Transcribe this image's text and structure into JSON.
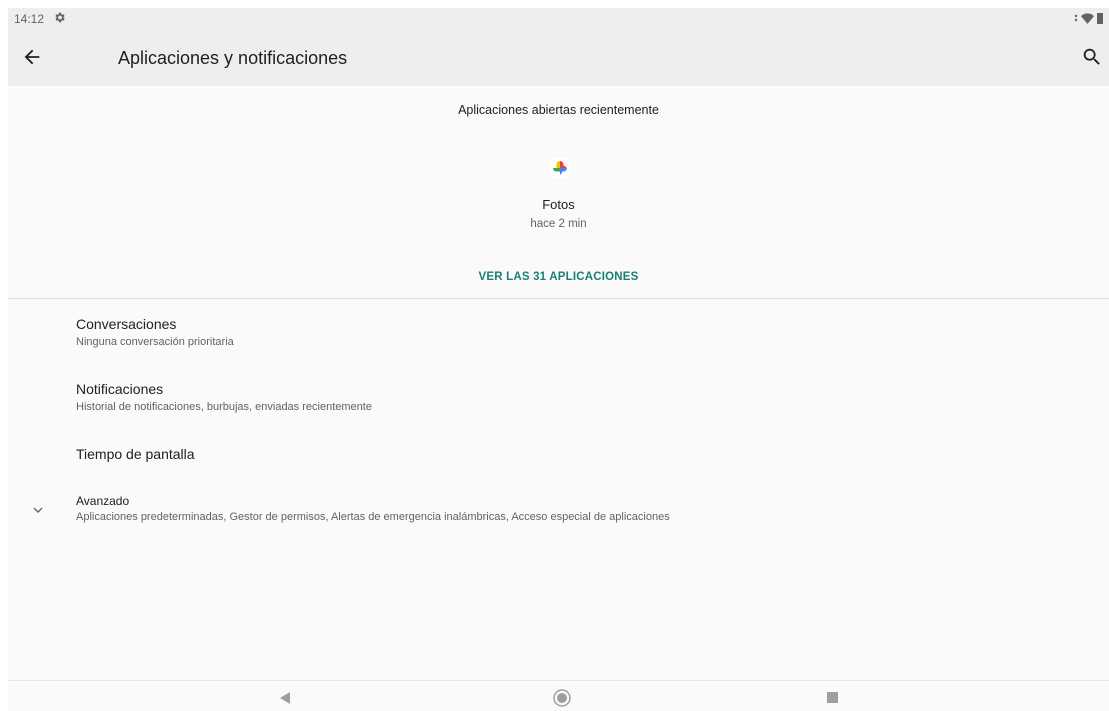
{
  "status_bar": {
    "time": "14:12",
    "icons": [
      "gear-icon",
      "wifi-icon",
      "battery-icon"
    ]
  },
  "toolbar": {
    "title": "Aplicaciones y notificaciones",
    "back_icon": "arrow-back-icon",
    "search_icon": "search-icon"
  },
  "recent_apps": {
    "header": "Aplicaciones abiertas recientemente",
    "apps": [
      {
        "name": "Fotos",
        "time": "hace 2 min",
        "icon": "pinwheel-photos-icon"
      }
    ],
    "see_all_label": "VER LAS 31 APLICACIONES"
  },
  "settings": {
    "items": [
      {
        "title": "Conversaciones",
        "summary": "Ninguna conversación prioritaria"
      },
      {
        "title": "Notificaciones",
        "summary": "Historial de notificaciones, burbujas, enviadas recientemente"
      },
      {
        "title": "Tiempo de pantalla",
        "summary": ""
      }
    ],
    "advanced": {
      "title": "Avanzado",
      "summary": "Aplicaciones predeterminadas, Gestor de permisos, Alertas de emergencia inalámbricas, Acceso especial de aplicaciones",
      "icon": "chevron-down-icon"
    }
  },
  "nav_bar": {
    "icons": [
      "nav-back-icon",
      "nav-home-icon",
      "nav-recents-icon"
    ]
  },
  "colors": {
    "accent": "#1a8075",
    "toolbar_bg": "#eeeeee",
    "page_bg": "#fafafa"
  }
}
